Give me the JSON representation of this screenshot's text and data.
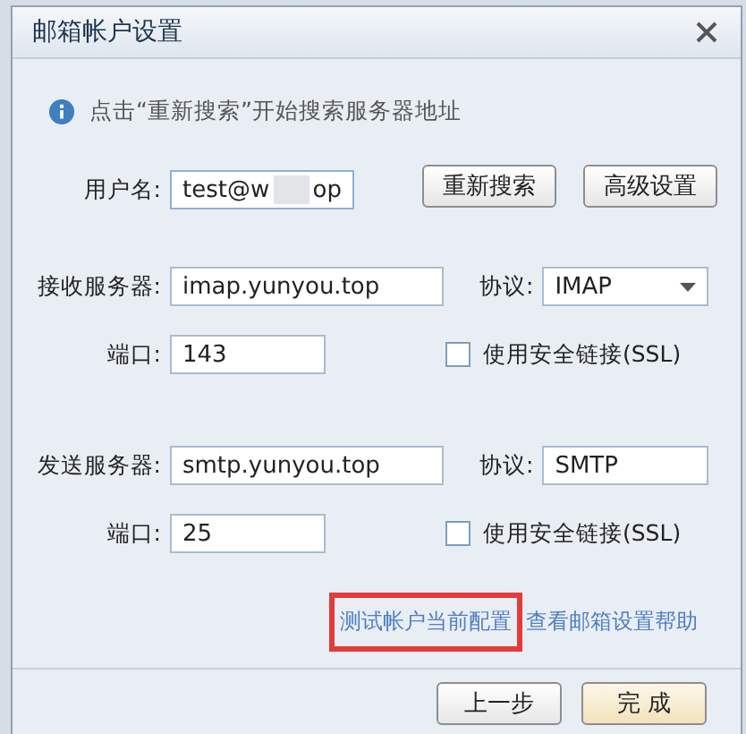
{
  "window": {
    "title": "邮箱帐户设置"
  },
  "hint": "点击“重新搜索”开始搜索服务器地址",
  "account": {
    "label": "用户名:",
    "value_start": "test@w",
    "value_end": "op",
    "redacted": true
  },
  "account_buttons": [
    "重新搜索",
    "高级设置"
  ],
  "servers": [
    {
      "label": "接收服务器:",
      "host": "imap.yunyou.top",
      "protocol_label": "协议:",
      "protocol": {
        "kind": "dropdown",
        "value": "IMAP"
      },
      "port_label": "端口:",
      "port": "143",
      "ssl_label": "使用安全链接(SSL)",
      "ssl_checked": false
    },
    {
      "label": "发送服务器:",
      "host": "smtp.yunyou.top",
      "protocol_label": "协议:",
      "protocol": {
        "kind": "text",
        "value": "SMTP"
      },
      "port_label": "端口:",
      "port": "25",
      "ssl_label": "使用安全链接(SSL)",
      "ssl_checked": false
    }
  ],
  "links": [
    {
      "text": "测试帐户当前配置",
      "highlighted": true
    },
    {
      "text": "查看邮箱设置帮助",
      "highlighted": false
    }
  ],
  "footer_buttons": [
    {
      "label": "上一步",
      "primary": false
    },
    {
      "label": "完 成",
      "primary": true
    }
  ]
}
